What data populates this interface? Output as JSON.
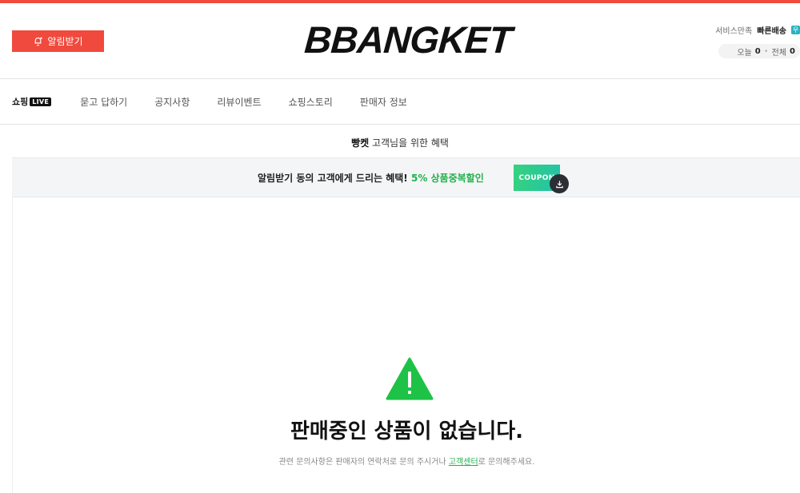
{
  "header": {
    "notify_label": "알림받기",
    "logo": "BBANGKET",
    "stats": {
      "service_label": "서비스만족",
      "fast_delivery_label": "빠른배송",
      "fast_delivery_badge": "우",
      "today_label": "오늘",
      "today_value": "0",
      "total_label": "전체",
      "total_value": "0"
    }
  },
  "nav": {
    "live_label": "쇼핑",
    "live_badge": "LIVE",
    "items": [
      "묻고 답하기",
      "공지사항",
      "리뷰이벤트",
      "쇼핑스토리",
      "판매자 정보"
    ]
  },
  "benefit": {
    "brand": "빵켓",
    "title_suffix": " 고객님을 위한 혜택"
  },
  "coupon": {
    "text_main": "알림받기 동의 고객에게 드리는 혜택! ",
    "text_highlight": "5% 상품중복할인",
    "button_label": "COUPON"
  },
  "empty": {
    "title": "판매중인 상품이 없습니다.",
    "desc_prefix": "관련 문의사항은 판매자의 연락처로 문의 주시거나 ",
    "desc_link": "고객센터",
    "desc_suffix": "로 문의해주세요."
  },
  "colors": {
    "accent_red": "#f04a3e",
    "accent_green": "#1fb24a"
  }
}
